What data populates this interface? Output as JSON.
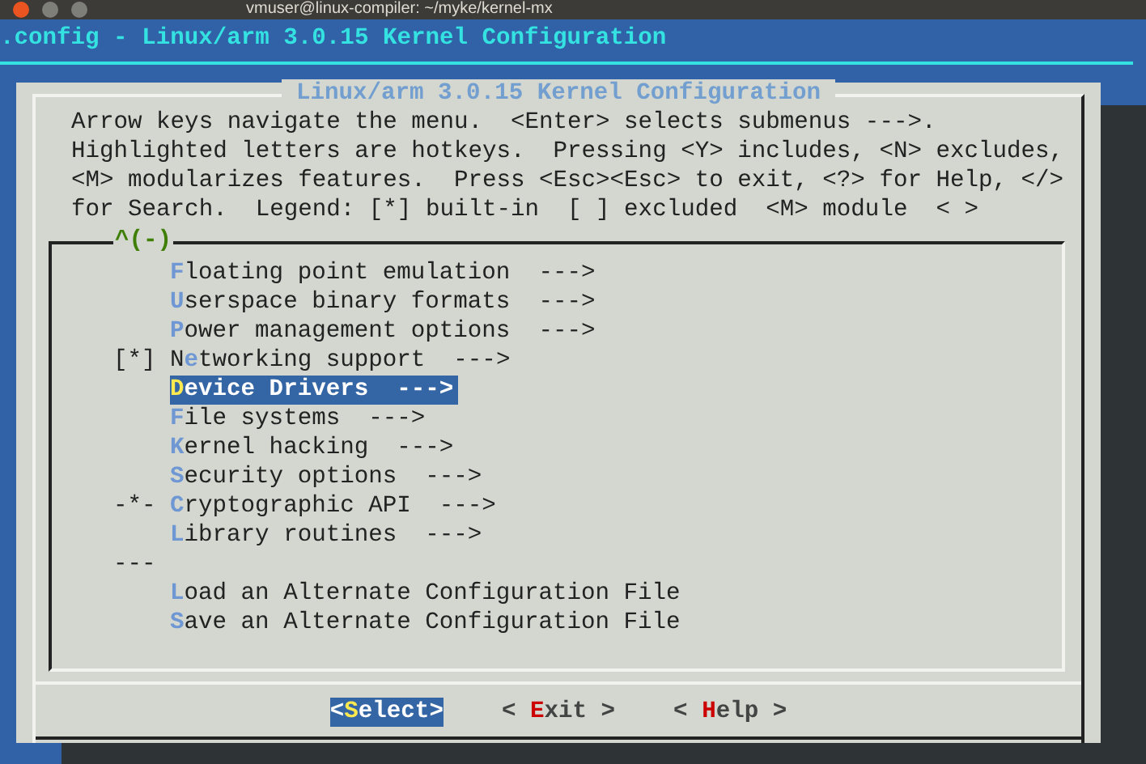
{
  "window": {
    "title": "vmuser@linux-compiler: ~/myke/kernel-mx"
  },
  "header": ".config - Linux/arm 3.0.15 Kernel Configuration",
  "dialog": {
    "title": "Linux/arm 3.0.15 Kernel Configuration",
    "help_lines": [
      "Arrow keys navigate the menu.  <Enter> selects submenus --->.",
      "Highlighted letters are hotkeys.  Pressing <Y> includes, <N> excludes,",
      "<M> modularizes features.  Press <Esc><Esc> to exit, <?> for Help, </>",
      "for Search.  Legend: [*] built-in  [ ] excluded  <M> module  < >"
    ],
    "scroll_indicator": "^(-)",
    "items": [
      {
        "kind": "entry",
        "key": "F",
        "after": "loating point emulation",
        "suffix": "--->",
        "selected": false
      },
      {
        "kind": "entry",
        "key": "U",
        "after": "serspace binary formats",
        "suffix": "--->",
        "selected": false
      },
      {
        "kind": "entry",
        "key": "P",
        "after": "ower management options",
        "suffix": "--->",
        "selected": false
      },
      {
        "kind": "entry",
        "prefix": "[*]",
        "before": "N",
        "key": "e",
        "after": "tworking support",
        "suffix": "--->",
        "selected": false
      },
      {
        "kind": "entry",
        "key": "D",
        "after": "evice Drivers",
        "suffix": "--->",
        "selected": true
      },
      {
        "kind": "entry",
        "key": "F",
        "after": "ile systems",
        "suffix": "--->",
        "selected": false
      },
      {
        "kind": "entry",
        "key": "K",
        "after": "ernel hacking",
        "suffix": "--->",
        "selected": false
      },
      {
        "kind": "entry",
        "key": "S",
        "after": "ecurity options",
        "suffix": "--->",
        "selected": false
      },
      {
        "kind": "entry",
        "prefix": "-*-",
        "key": "C",
        "after": "ryptographic API",
        "suffix": "--->",
        "selected": false
      },
      {
        "kind": "entry",
        "key": "L",
        "after": "ibrary routines",
        "suffix": "--->",
        "selected": false
      },
      {
        "kind": "separator",
        "prefix": "---"
      },
      {
        "kind": "entry",
        "key": "L",
        "after": "oad an Alternate Configuration File",
        "selected": false
      },
      {
        "kind": "entry",
        "key": "S",
        "after": "ave an Alternate Configuration File",
        "selected": false
      }
    ],
    "buttons": [
      {
        "left": "<",
        "key": "S",
        "rest": "elect",
        "right": ">",
        "selected": true
      },
      {
        "left": "< ",
        "key": "E",
        "rest": "xit",
        "right": " >",
        "selected": false
      },
      {
        "left": "< ",
        "key": "H",
        "rest": "elp",
        "right": " >",
        "selected": false
      }
    ]
  }
}
